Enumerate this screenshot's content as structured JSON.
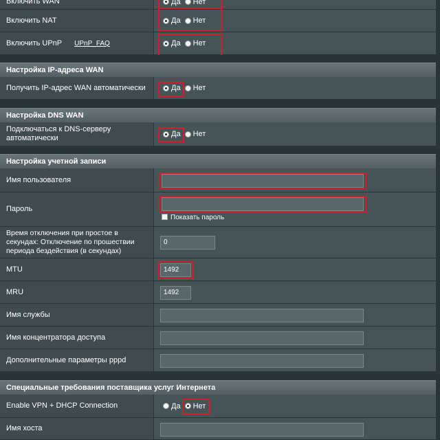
{
  "options": {
    "yes": "Да",
    "no": "Нет"
  },
  "top_partial": {
    "label": "Включить WAN"
  },
  "nat": {
    "label": "Включить NAT"
  },
  "upnp": {
    "label": "Включить UPnP",
    "link": "UPnP_FAQ"
  },
  "wan_ip": {
    "title": "Настройка IP-адреса WAN",
    "auto_ip_label": "Получить IP-адрес WAN автоматически"
  },
  "wan_dns": {
    "title": "Настройка DNS WAN",
    "auto_dns_label": "Подключаться к DNS-серверу автоматически"
  },
  "account": {
    "title": "Настройка учетной записи",
    "username_label": "Имя пользователя",
    "username_value": "",
    "password_label": "Пароль",
    "password_value": "",
    "show_password_label": "Показать пароль",
    "idle_label": "Время отключения при простое в секундах: Отключение по прошествии периода бездействия (в секундах)",
    "idle_value": "0",
    "mtu_label": "MTU",
    "mtu_value": "1492",
    "mru_label": "MRU",
    "mru_value": "1492",
    "service_label": "Имя службы",
    "service_value": "",
    "concentrator_label": "Имя концентратора доступа",
    "concentrator_value": "",
    "pppd_label": "Дополнительные параметры pppd",
    "pppd_value": ""
  },
  "isp": {
    "title": "Специальные требования поставщика услуг Интернета",
    "vpn_dhcp_label": "Enable VPN + DHCP Connection",
    "hostname_label": "Имя хоста",
    "hostname_value": ""
  },
  "colors": {
    "highlight": "#d11e2a",
    "row_bg": "#465458",
    "label_bg": "#3f4b4f",
    "section_bg": "#5f6a6e"
  }
}
